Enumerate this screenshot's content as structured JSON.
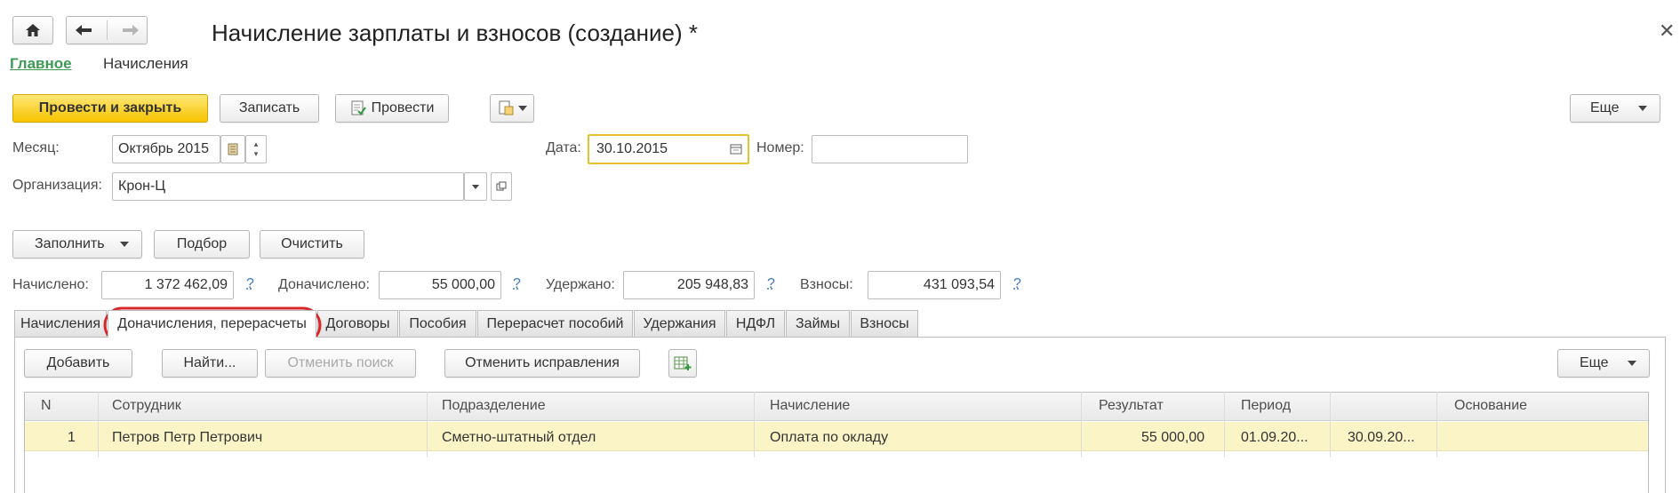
{
  "window": {
    "title": "Начисление зарплаты и взносов (создание) *",
    "nav_main": "Главное",
    "nav_accruals": "Начисления"
  },
  "toolbar": {
    "post_close": "Провести и закрыть",
    "save": "Записать",
    "post": "Провести",
    "more": "Еще"
  },
  "form": {
    "month_label": "Месяц:",
    "month_value": "Октябрь 2015",
    "date_label": "Дата:",
    "date_value": "30.10.2015",
    "number_label": "Номер:",
    "number_value": "",
    "org_label": "Организация:",
    "org_value": "Крон-Ц"
  },
  "actions": {
    "fill": "Заполнить",
    "select": "Подбор",
    "clear": "Очистить"
  },
  "totals": {
    "accrued_label": "Начислено:",
    "accrued_value": "1 372 462,09",
    "additional_label": "Доначислено:",
    "additional_value": "55 000,00",
    "withheld_label": "Удержано:",
    "withheld_value": "205 948,83",
    "contrib_label": "Взносы:",
    "contrib_value": "431 093,54",
    "help_mark": "?"
  },
  "tabs": [
    {
      "label": "Начисления"
    },
    {
      "label": "Доначисления, перерасчеты"
    },
    {
      "label": "Договоры"
    },
    {
      "label": "Пособия"
    },
    {
      "label": "Перерасчет пособий"
    },
    {
      "label": "Удержания"
    },
    {
      "label": "НДФЛ"
    },
    {
      "label": "Займы"
    },
    {
      "label": "Взносы"
    }
  ],
  "table_toolbar": {
    "add": "Добавить",
    "find": "Найти...",
    "cancel_search": "Отменить поиск",
    "cancel_fix": "Отменить исправления",
    "more": "Еще"
  },
  "table": {
    "columns": [
      "N",
      "Сотрудник",
      "Подразделение",
      "Начисление",
      "Результат",
      "Период",
      "",
      "Основание"
    ],
    "rows": [
      {
        "n": "1",
        "employee": "Петров Петр Петрович",
        "department": "Сметно-штатный отдел",
        "accrual": "Оплата по окладу",
        "result": "55 000,00",
        "period_from": "01.09.20...",
        "period_to": "30.09.20...",
        "basis": ""
      }
    ]
  },
  "colors": {
    "accent_yellow": "#f6c400",
    "link_green": "#3d9a55",
    "highlight_red": "#d9262a",
    "row_selected": "#fbf4c7"
  }
}
